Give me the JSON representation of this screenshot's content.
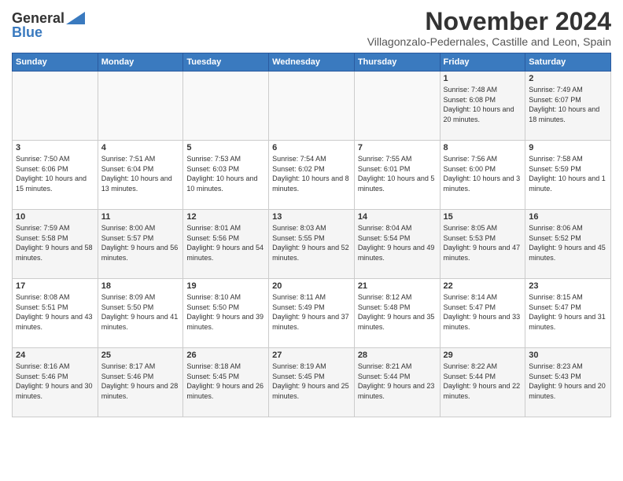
{
  "header": {
    "logo_general": "General",
    "logo_blue": "Blue",
    "month_title": "November 2024",
    "subtitle": "Villagonzalo-Pedernales, Castille and Leon, Spain"
  },
  "days_of_week": [
    "Sunday",
    "Monday",
    "Tuesday",
    "Wednesday",
    "Thursday",
    "Friday",
    "Saturday"
  ],
  "weeks": [
    [
      {
        "day": "",
        "info": ""
      },
      {
        "day": "",
        "info": ""
      },
      {
        "day": "",
        "info": ""
      },
      {
        "day": "",
        "info": ""
      },
      {
        "day": "",
        "info": ""
      },
      {
        "day": "1",
        "info": "Sunrise: 7:48 AM\nSunset: 6:08 PM\nDaylight: 10 hours and 20 minutes."
      },
      {
        "day": "2",
        "info": "Sunrise: 7:49 AM\nSunset: 6:07 PM\nDaylight: 10 hours and 18 minutes."
      }
    ],
    [
      {
        "day": "3",
        "info": "Sunrise: 7:50 AM\nSunset: 6:06 PM\nDaylight: 10 hours and 15 minutes."
      },
      {
        "day": "4",
        "info": "Sunrise: 7:51 AM\nSunset: 6:04 PM\nDaylight: 10 hours and 13 minutes."
      },
      {
        "day": "5",
        "info": "Sunrise: 7:53 AM\nSunset: 6:03 PM\nDaylight: 10 hours and 10 minutes."
      },
      {
        "day": "6",
        "info": "Sunrise: 7:54 AM\nSunset: 6:02 PM\nDaylight: 10 hours and 8 minutes."
      },
      {
        "day": "7",
        "info": "Sunrise: 7:55 AM\nSunset: 6:01 PM\nDaylight: 10 hours and 5 minutes."
      },
      {
        "day": "8",
        "info": "Sunrise: 7:56 AM\nSunset: 6:00 PM\nDaylight: 10 hours and 3 minutes."
      },
      {
        "day": "9",
        "info": "Sunrise: 7:58 AM\nSunset: 5:59 PM\nDaylight: 10 hours and 1 minute."
      }
    ],
    [
      {
        "day": "10",
        "info": "Sunrise: 7:59 AM\nSunset: 5:58 PM\nDaylight: 9 hours and 58 minutes."
      },
      {
        "day": "11",
        "info": "Sunrise: 8:00 AM\nSunset: 5:57 PM\nDaylight: 9 hours and 56 minutes."
      },
      {
        "day": "12",
        "info": "Sunrise: 8:01 AM\nSunset: 5:56 PM\nDaylight: 9 hours and 54 minutes."
      },
      {
        "day": "13",
        "info": "Sunrise: 8:03 AM\nSunset: 5:55 PM\nDaylight: 9 hours and 52 minutes."
      },
      {
        "day": "14",
        "info": "Sunrise: 8:04 AM\nSunset: 5:54 PM\nDaylight: 9 hours and 49 minutes."
      },
      {
        "day": "15",
        "info": "Sunrise: 8:05 AM\nSunset: 5:53 PM\nDaylight: 9 hours and 47 minutes."
      },
      {
        "day": "16",
        "info": "Sunrise: 8:06 AM\nSunset: 5:52 PM\nDaylight: 9 hours and 45 minutes."
      }
    ],
    [
      {
        "day": "17",
        "info": "Sunrise: 8:08 AM\nSunset: 5:51 PM\nDaylight: 9 hours and 43 minutes."
      },
      {
        "day": "18",
        "info": "Sunrise: 8:09 AM\nSunset: 5:50 PM\nDaylight: 9 hours and 41 minutes."
      },
      {
        "day": "19",
        "info": "Sunrise: 8:10 AM\nSunset: 5:50 PM\nDaylight: 9 hours and 39 minutes."
      },
      {
        "day": "20",
        "info": "Sunrise: 8:11 AM\nSunset: 5:49 PM\nDaylight: 9 hours and 37 minutes."
      },
      {
        "day": "21",
        "info": "Sunrise: 8:12 AM\nSunset: 5:48 PM\nDaylight: 9 hours and 35 minutes."
      },
      {
        "day": "22",
        "info": "Sunrise: 8:14 AM\nSunset: 5:47 PM\nDaylight: 9 hours and 33 minutes."
      },
      {
        "day": "23",
        "info": "Sunrise: 8:15 AM\nSunset: 5:47 PM\nDaylight: 9 hours and 31 minutes."
      }
    ],
    [
      {
        "day": "24",
        "info": "Sunrise: 8:16 AM\nSunset: 5:46 PM\nDaylight: 9 hours and 30 minutes."
      },
      {
        "day": "25",
        "info": "Sunrise: 8:17 AM\nSunset: 5:46 PM\nDaylight: 9 hours and 28 minutes."
      },
      {
        "day": "26",
        "info": "Sunrise: 8:18 AM\nSunset: 5:45 PM\nDaylight: 9 hours and 26 minutes."
      },
      {
        "day": "27",
        "info": "Sunrise: 8:19 AM\nSunset: 5:45 PM\nDaylight: 9 hours and 25 minutes."
      },
      {
        "day": "28",
        "info": "Sunrise: 8:21 AM\nSunset: 5:44 PM\nDaylight: 9 hours and 23 minutes."
      },
      {
        "day": "29",
        "info": "Sunrise: 8:22 AM\nSunset: 5:44 PM\nDaylight: 9 hours and 22 minutes."
      },
      {
        "day": "30",
        "info": "Sunrise: 8:23 AM\nSunset: 5:43 PM\nDaylight: 9 hours and 20 minutes."
      }
    ]
  ]
}
